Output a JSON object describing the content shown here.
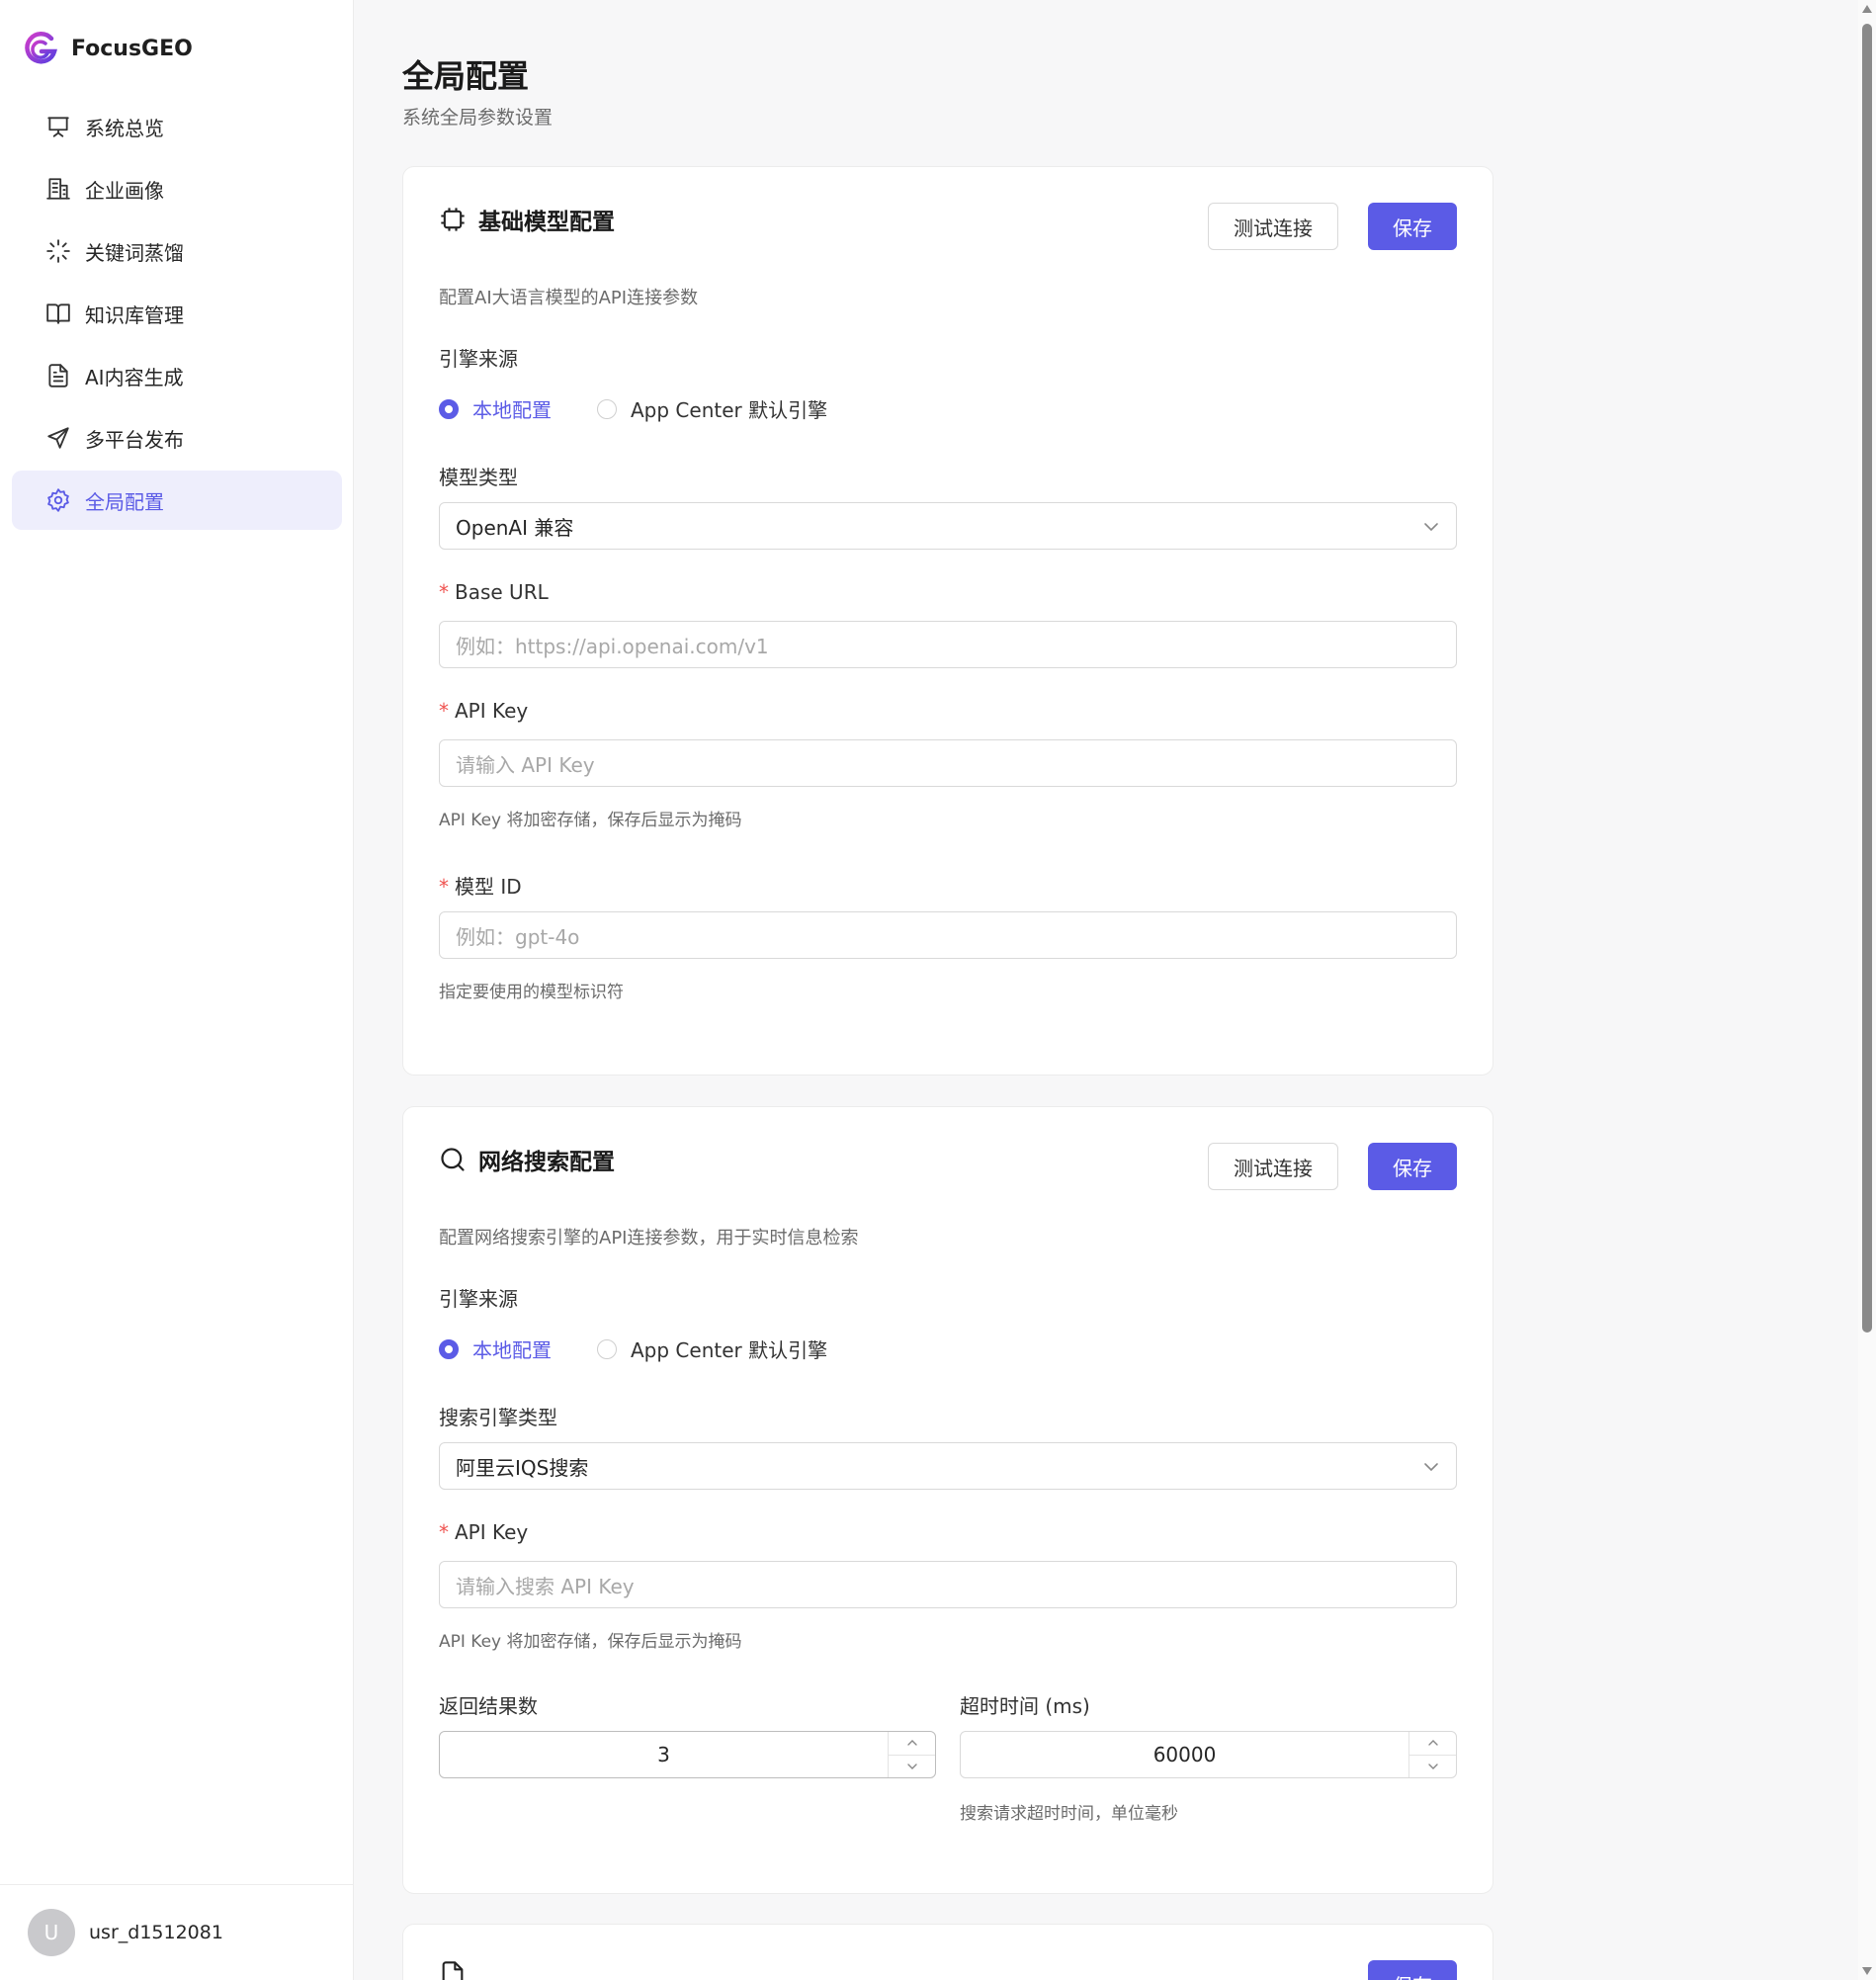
{
  "app": {
    "brand_name": "FocusGEO"
  },
  "sidebar": {
    "items": [
      {
        "label": "系统总览",
        "icon": "presentation-icon"
      },
      {
        "label": "企业画像",
        "icon": "building-icon"
      },
      {
        "label": "关键词蒸馏",
        "icon": "loader-icon"
      },
      {
        "label": "知识库管理",
        "icon": "book-icon"
      },
      {
        "label": "AI内容生成",
        "icon": "document-icon"
      },
      {
        "label": "多平台发布",
        "icon": "send-icon"
      },
      {
        "label": "全局配置",
        "icon": "gear-icon",
        "active": true
      }
    ],
    "user": {
      "avatar_letter": "U",
      "username": "usr_d1512081"
    }
  },
  "page": {
    "title": "全局配置",
    "subtitle": "系统全局参数设置"
  },
  "colors": {
    "accent": "#5b5be6",
    "required": "#ef5350"
  },
  "model_config": {
    "title": "基础模型配置",
    "test_button": "测试连接",
    "save_button": "保存",
    "description": "配置AI大语言模型的API连接参数",
    "engine_source_label": "引擎来源",
    "engine_options": [
      "本地配置",
      "App Center 默认引擎"
    ],
    "engine_selected": "本地配置",
    "model_type_label": "模型类型",
    "model_type_value": "OpenAI 兼容",
    "base_url_label": "Base URL",
    "base_url_placeholder": "例如：https://api.openai.com/v1",
    "api_key_label": "API Key",
    "api_key_placeholder": "请输入 API Key",
    "api_key_hint": "API Key 将加密存储，保存后显示为掩码",
    "model_id_label": "模型 ID",
    "model_id_placeholder": "例如：gpt-4o",
    "model_id_hint": "指定要使用的模型标识符"
  },
  "search_config": {
    "title": "网络搜索配置",
    "test_button": "测试连接",
    "save_button": "保存",
    "description": "配置网络搜索引擎的API连接参数，用于实时信息检索",
    "engine_source_label": "引擎来源",
    "engine_options": [
      "本地配置",
      "App Center 默认引擎"
    ],
    "engine_selected": "本地配置",
    "engine_type_label": "搜索引擎类型",
    "engine_type_value": "阿里云IQS搜索",
    "api_key_label": "API Key",
    "api_key_placeholder": "请输入搜索 API Key",
    "api_key_hint": "API Key 将加密存储，保存后显示为掩码",
    "result_count_label": "返回结果数",
    "result_count_value": "3",
    "timeout_label": "超时时间 (ms)",
    "timeout_value": "60000",
    "timeout_hint": "搜索请求超时时间，单位毫秒"
  },
  "third_card": {
    "save_button": "保存"
  }
}
